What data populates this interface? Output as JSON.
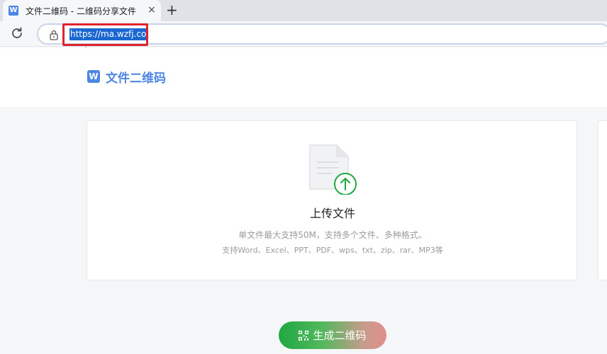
{
  "browser": {
    "tab": {
      "favicon_letter": "W",
      "title": "文件二维码 - 二维码分享文件",
      "close_glyph": "×"
    },
    "new_tab_glyph": "+",
    "address_bar": {
      "url_selected": "https://ma.wzfj.co"
    }
  },
  "site": {
    "logo_letter": "W",
    "logo_text": "文件二维码"
  },
  "upload": {
    "title": "上传文件",
    "desc_line1": "单文件最大支持50M，支持多个文件、多种格式。",
    "desc_line2": "支持Word、Excel、PPT、PDF、wps、txt、zip、rar、MP3等"
  },
  "generate_button": {
    "label": "生成二维码"
  },
  "colors": {
    "brand_blue": "#4e86e4",
    "annotation_red": "#e0242d",
    "upload_green": "#1fa843"
  }
}
